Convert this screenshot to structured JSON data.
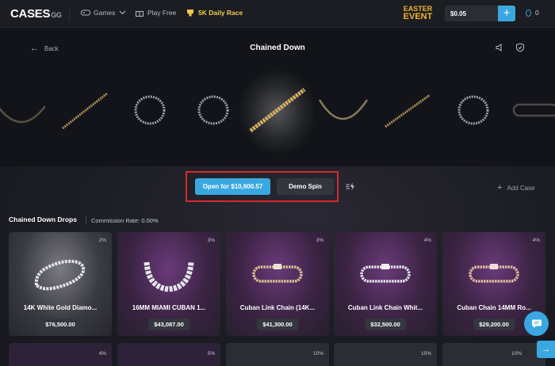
{
  "nav": {
    "logo_main": "CASES",
    "logo_suffix": "GG",
    "games_label": "Games",
    "playfree_label": "Play Free",
    "race_label": "5K Daily Race",
    "easter_line1": "EASTER",
    "easter_line2": "EVENT",
    "balance": "$0.05",
    "plus_label": "+",
    "coins": "0"
  },
  "case": {
    "back_label": "Back",
    "title": "Chained Down"
  },
  "controls": {
    "open_label": "Open for $10,600.57",
    "demo_label": "Demo Spin",
    "add_case_label": "Add Case"
  },
  "drops": {
    "title": "Chained Down Drops",
    "commission": "Commission Rate: 0.00%",
    "items": [
      {
        "name": "14K White Gold Diamo...",
        "price": "$76,500.00",
        "pct": "2%"
      },
      {
        "name": "16MM MIAMI CUBAN 1...",
        "price": "$43,087.00",
        "pct": "3%"
      },
      {
        "name": "Cuban Link Chain (14K...",
        "price": "$41,300.00",
        "pct": "3%"
      },
      {
        "name": "Cuban Link Chain Whit...",
        "price": "$32,500.00",
        "pct": "4%"
      },
      {
        "name": "Cuban Chain 14MM Ro...",
        "price": "$29,200.00",
        "pct": "4%"
      }
    ],
    "row2_pcts": [
      "4%",
      "5%",
      "10%",
      "10%",
      "10%"
    ]
  },
  "colors": {
    "accent": "#3aa8e0",
    "gold": "#f2c94c",
    "highlight": "#d32b2b"
  }
}
